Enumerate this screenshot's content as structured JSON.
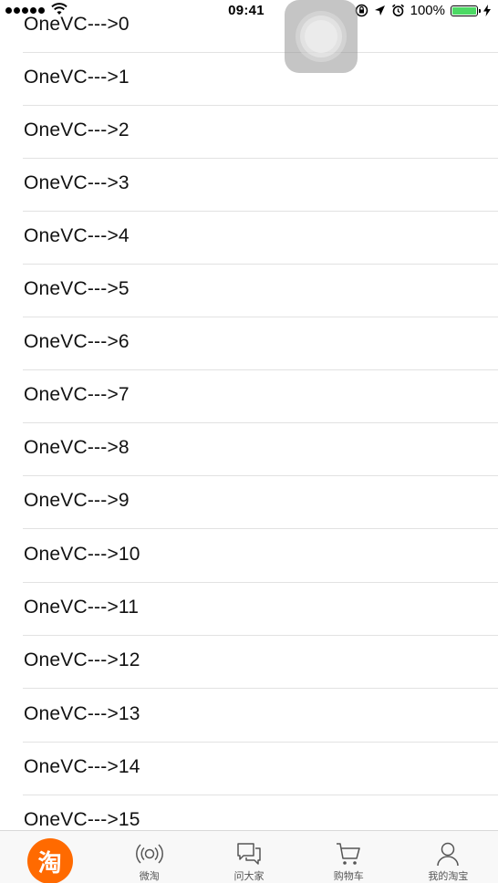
{
  "status_bar": {
    "time": "09:41",
    "battery_percent": "100%",
    "battery_level": 1.0,
    "battery_color": "#4cd964"
  },
  "list": {
    "items": [
      "OneVC--->0",
      "OneVC--->1",
      "OneVC--->2",
      "OneVC--->3",
      "OneVC--->4",
      "OneVC--->5",
      "OneVC--->6",
      "OneVC--->7",
      "OneVC--->8",
      "OneVC--->9",
      "OneVC--->10",
      "OneVC--->11",
      "OneVC--->12",
      "OneVC--->13",
      "OneVC--->14",
      "OneVC--->15"
    ]
  },
  "tab_bar": {
    "home_badge_text": "淘",
    "home_color": "#ff6a00",
    "tabs": [
      {
        "label": "微淘",
        "icon": "broadcast-icon"
      },
      {
        "label": "问大家",
        "icon": "chat-bubbles-icon"
      },
      {
        "label": "购物车",
        "icon": "shopping-cart-icon"
      },
      {
        "label": "我的淘宝",
        "icon": "person-icon"
      }
    ]
  }
}
